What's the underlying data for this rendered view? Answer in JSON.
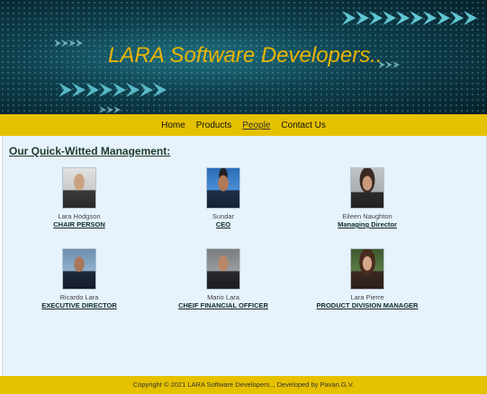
{
  "banner": {
    "title": "LARA Software Developers.."
  },
  "nav": {
    "items": [
      "Home",
      "Products",
      "People",
      "Contact Us"
    ],
    "active": "People"
  },
  "section": {
    "heading": "Our Quick-Witted Management:"
  },
  "people": [
    {
      "name": "Lara Hodgson",
      "role": "CHAIR PERSON"
    },
    {
      "name": "Sundar",
      "role": "CEO"
    },
    {
      "name": "Eileen Naughton",
      "role": "Managing Director"
    },
    {
      "name": "Ricardo Lara",
      "role": "EXECUTIVE DIRECTOR"
    },
    {
      "name": "Mario Lara",
      "role": "CHEIF FINANCIAL OFFICER"
    },
    {
      "name": "Lara Pierre",
      "role": "PRODUCT DIVISION MANAGER"
    }
  ],
  "footer": {
    "text": "Copyright © 2021 LARA Software Developers.., Developed by Pavan.G.V."
  }
}
